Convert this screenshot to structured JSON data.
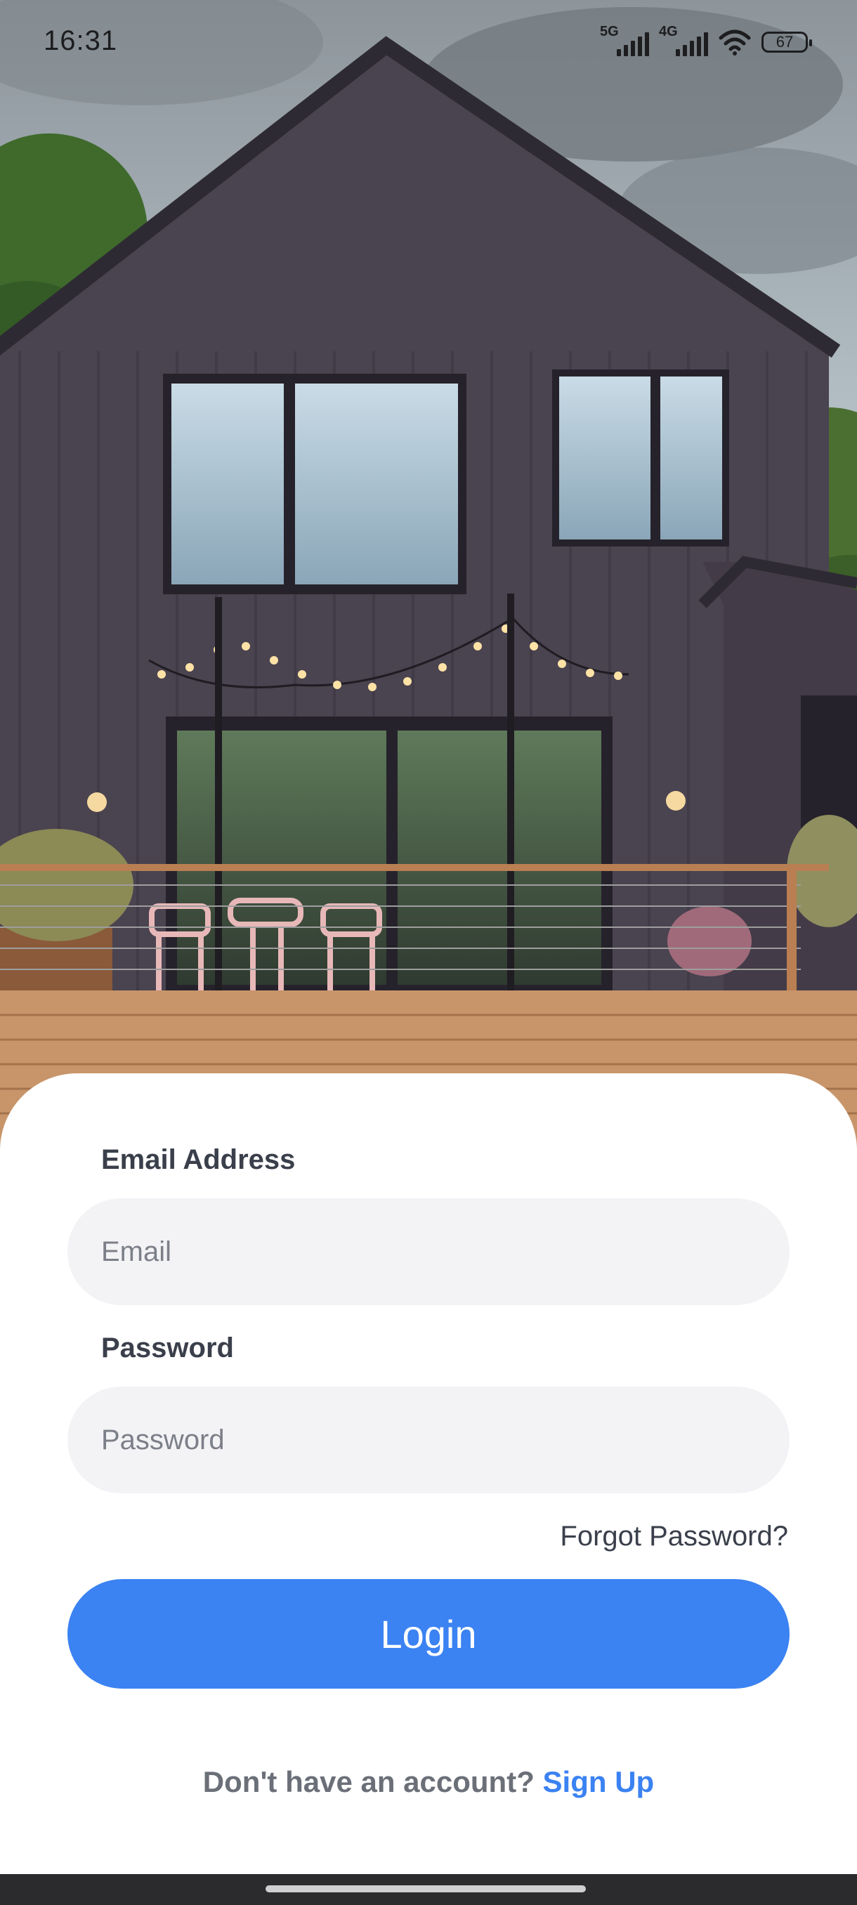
{
  "status_bar": {
    "time": "16:31",
    "network_1": "5G",
    "network_2": "4G",
    "battery": "67",
    "icons": [
      "signal-icon",
      "signal-icon",
      "wifi-icon",
      "battery-icon"
    ]
  },
  "hero": {
    "image": "house-photo",
    "colors": {
      "siding": "#4a4350",
      "sky": "#c9d3d8",
      "deck": "#c8956a"
    }
  },
  "login_form": {
    "email_label": "Email Address",
    "email_placeholder": "Email",
    "email_value": "",
    "password_label": "Password",
    "password_placeholder": "Password",
    "password_value": "",
    "forgot_password": "Forgot Password?",
    "login_button": "Login",
    "signup_prompt": "Don't have an account?",
    "signup_link": "Sign Up"
  },
  "theme": {
    "accent": "#3b82f2",
    "input_bg": "#f3f3f6",
    "label": "#3a3f4b"
  }
}
